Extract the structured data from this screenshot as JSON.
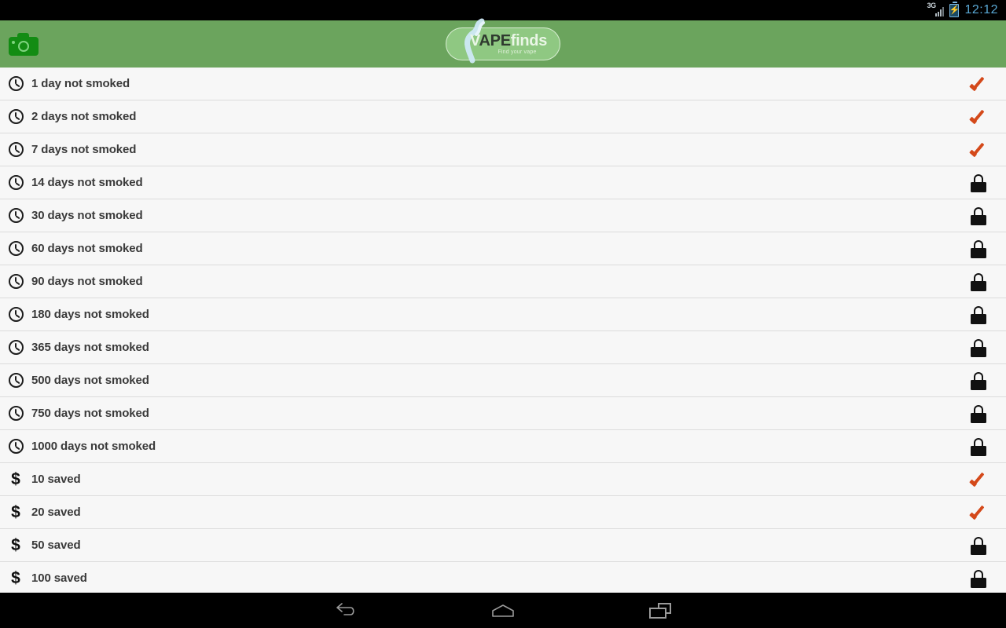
{
  "statusbar": {
    "network_label": "3G",
    "network_icon": "signal-bars-icon",
    "battery_icon": "battery-charging-icon",
    "time": "12:12"
  },
  "appbar": {
    "camera_icon": "camera-icon",
    "logo": {
      "name": "VAPEfinds",
      "part_v": "V",
      "part_ape": "APE",
      "part_finds": "finds",
      "tagline": "Find your vape",
      "vapor_icon": "vapor-swirl-icon"
    },
    "background_color": "#6ba45d"
  },
  "colors": {
    "header_green": "#6ba45d",
    "logo_pill_green": "#8fc882",
    "row_bg": "#f7f7f7",
    "divider": "#dcdcdc",
    "check_orange": "#d4491a",
    "lock_black": "#111111",
    "text": "#3a3a3a",
    "status_time_blue": "#5aa9d6"
  },
  "achievements": {
    "status_values": {
      "unlocked": "unlocked",
      "locked": "locked"
    },
    "icon_names": {
      "time": "clock-icon",
      "money": "dollar-icon",
      "unlocked": "check-icon",
      "locked": "lock-icon"
    },
    "items": [
      {
        "label": "1 day not smoked",
        "type": "time",
        "status": "unlocked"
      },
      {
        "label": "2 days not smoked",
        "type": "time",
        "status": "unlocked"
      },
      {
        "label": "7 days not smoked",
        "type": "time",
        "status": "unlocked"
      },
      {
        "label": "14 days not smoked",
        "type": "time",
        "status": "locked"
      },
      {
        "label": "30 days not smoked",
        "type": "time",
        "status": "locked"
      },
      {
        "label": "60 days not smoked",
        "type": "time",
        "status": "locked"
      },
      {
        "label": "90 days not smoked",
        "type": "time",
        "status": "locked"
      },
      {
        "label": "180 days not smoked",
        "type": "time",
        "status": "locked"
      },
      {
        "label": "365 days not smoked",
        "type": "time",
        "status": "locked"
      },
      {
        "label": "500 days not smoked",
        "type": "time",
        "status": "locked"
      },
      {
        "label": "750 days not smoked",
        "type": "time",
        "status": "locked"
      },
      {
        "label": "1000 days not smoked",
        "type": "time",
        "status": "locked"
      },
      {
        "label": "10 saved",
        "type": "money",
        "status": "unlocked"
      },
      {
        "label": "20 saved",
        "type": "money",
        "status": "unlocked"
      },
      {
        "label": "50 saved",
        "type": "money",
        "status": "locked"
      },
      {
        "label": "100 saved",
        "type": "money",
        "status": "locked"
      }
    ]
  },
  "navbar": {
    "back_icon": "back-arrow-icon",
    "home_icon": "home-icon",
    "recents_icon": "recent-apps-icon"
  }
}
